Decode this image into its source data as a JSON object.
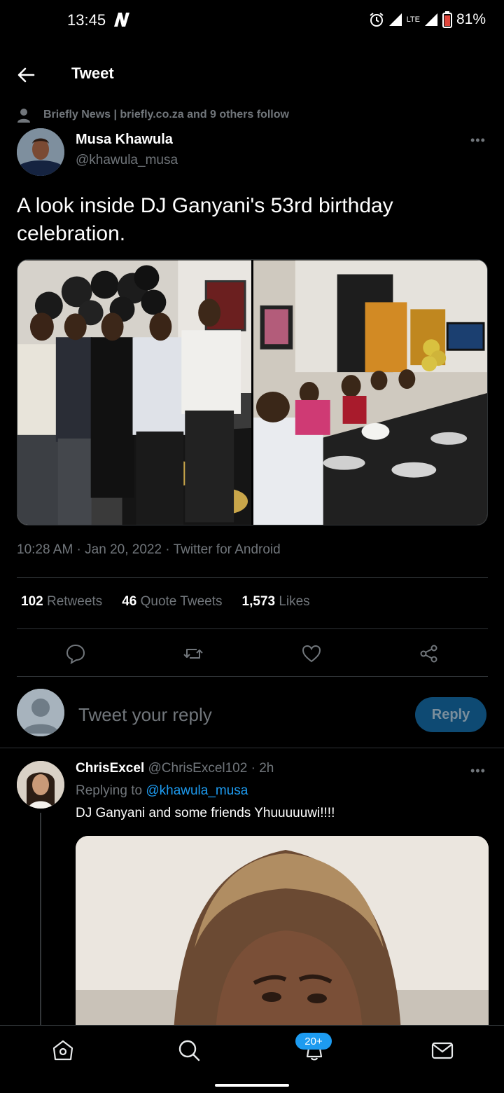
{
  "status_bar": {
    "time": "13:45",
    "battery": "81%",
    "network": "LTE"
  },
  "header": {
    "title": "Tweet"
  },
  "tweet": {
    "social_context": "Briefly News | briefly.co.za and 9 others follow",
    "author_name": "Musa Khawula",
    "author_handle": "@khawula_musa",
    "text": "A look inside DJ Ganyani's 53rd birthday celebration.",
    "meta": "10:28 AM · Jan 20, 2022 · Twitter for Android",
    "stats": {
      "retweets_count": "102",
      "retweets_label": "Retweets",
      "quotes_count": "46",
      "quotes_label": "Quote Tweets",
      "likes_count": "1,573",
      "likes_label": "Likes"
    }
  },
  "reply_box": {
    "placeholder": "Tweet your reply",
    "button_label": "Reply"
  },
  "reply": {
    "name": "ChrisExcel",
    "handle": "@ChrisExcel102",
    "time": "· 2h",
    "replying_to_label": "Replying to",
    "replying_to_handle": "@khawula_musa",
    "text": "DJ Ganyani and some friends Yhuuuuuwi!!!!"
  },
  "bottom_nav": {
    "notifications_badge": "20+"
  },
  "colors": {
    "background": "#000000",
    "accent": "#1d9bf0",
    "muted": "#71767b",
    "divider": "#2f3336"
  }
}
